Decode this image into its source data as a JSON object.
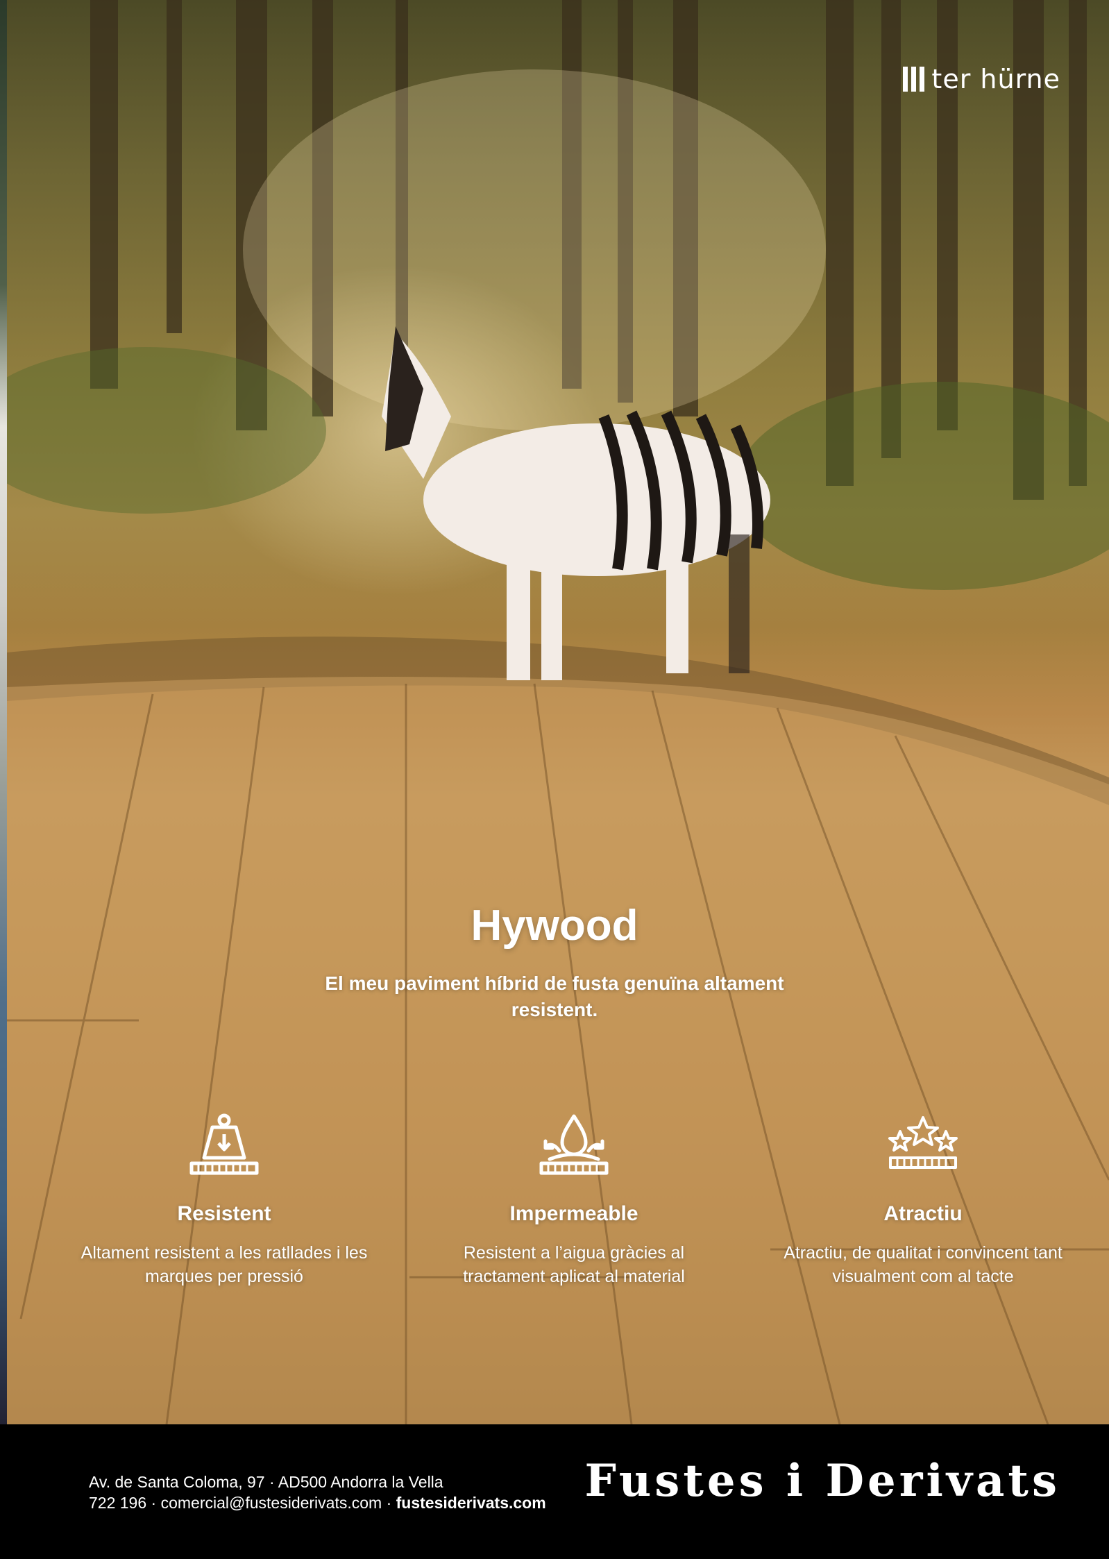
{
  "brand": {
    "logo_text": "ter hürne"
  },
  "hero": {
    "title": "Hywood",
    "subtitle": "El meu paviment híbrid de fusta genuïna altament resistent."
  },
  "features": [
    {
      "icon": "weight-scale-icon",
      "title": "Resistent",
      "text": "Altament resistent a les ratllades i les marques per pressió"
    },
    {
      "icon": "water-drop-icon",
      "title": "Impermeable",
      "text": "Resistent a l’aigua gràcies al tractament aplicat al material"
    },
    {
      "icon": "stars-icon",
      "title": "Atractiu",
      "text": "Atractiu, de qualitat i convincent tant visualment com al tacte"
    }
  ],
  "footer": {
    "address_line": "Av. de Santa Coloma, 97 · AD500 Andorra la Vella",
    "contact_line": "722 196 · comercial@fustesiderivats.com · ",
    "website": "fustesiderivats.com",
    "company_name": "Fustes i Derivats"
  },
  "colors": {
    "footer_bg": "#000000",
    "text": "#ffffff",
    "wood": "#c69a5c"
  }
}
